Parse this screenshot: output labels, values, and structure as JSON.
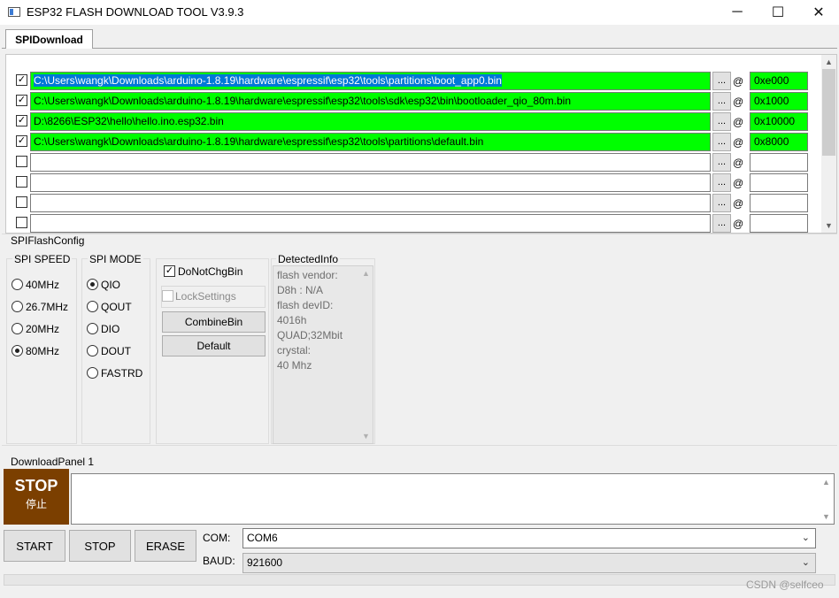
{
  "window": {
    "title": "ESP32 FLASH DOWNLOAD TOOL V3.9.3",
    "minimize_symbol": "─",
    "maximize_symbol": "☐",
    "close_symbol": "✕"
  },
  "tabs": [
    {
      "label": "SPIDownload"
    }
  ],
  "files": [
    {
      "checked": true,
      "check_mark": "✓",
      "path_highlight": "C:\\Users\\wangk\\Downloads\\arduino-1.8.19\\hardware\\espressif\\esp32\\tools\\partitions\\boot_app0.bin",
      "path": "",
      "browse": "...",
      "at": "@",
      "address": "0xe000"
    },
    {
      "checked": true,
      "check_mark": "✓",
      "path_highlight": "",
      "path": "C:\\Users\\wangk\\Downloads\\arduino-1.8.19\\hardware\\espressif\\esp32\\tools\\sdk\\esp32\\bin\\bootloader_qio_80m.bin",
      "browse": "...",
      "at": "@",
      "address": "0x1000"
    },
    {
      "checked": true,
      "check_mark": "✓",
      "path_highlight": "",
      "path": "D:\\8266\\ESP32\\hello\\hello.ino.esp32.bin",
      "browse": "...",
      "at": "@",
      "address": "0x10000"
    },
    {
      "checked": true,
      "check_mark": "✓",
      "path_highlight": "",
      "path": "C:\\Users\\wangk\\Downloads\\arduino-1.8.19\\hardware\\espressif\\esp32\\tools\\partitions\\default.bin",
      "browse": "...",
      "at": "@",
      "address": "0x8000"
    },
    {
      "checked": false,
      "check_mark": "",
      "path_highlight": "",
      "path": "",
      "browse": "...",
      "at": "@",
      "address": ""
    },
    {
      "checked": false,
      "check_mark": "",
      "path_highlight": "",
      "path": "",
      "browse": "...",
      "at": "@",
      "address": ""
    },
    {
      "checked": false,
      "check_mark": "",
      "path_highlight": "",
      "path": "",
      "browse": "...",
      "at": "@",
      "address": ""
    },
    {
      "checked": false,
      "check_mark": "",
      "path_highlight": "",
      "path": "",
      "browse": "...",
      "at": "@",
      "address": ""
    }
  ],
  "scroll": {
    "up_arrow": "▲",
    "down_arrow": "▼"
  },
  "config": {
    "title": "SPIFlashConfig",
    "spi_speed": {
      "title": "SPI SPEED",
      "options": [
        "40MHz",
        "26.7MHz",
        "20MHz",
        "80MHz"
      ],
      "selected": "80MHz"
    },
    "spi_mode": {
      "title": "SPI MODE",
      "options": [
        "QIO",
        "QOUT",
        "DIO",
        "DOUT",
        "FASTRD"
      ],
      "selected": "QIO"
    },
    "do_not_chg_bin": {
      "label": "DoNotChgBin",
      "checked": true,
      "check_mark": "✓"
    },
    "lock_settings": {
      "label": "LockSettings",
      "checked": false
    },
    "combine_bin_label": "CombineBin",
    "default_label": "Default",
    "detected_info": {
      "title": "DetectedInfo",
      "lines": [
        "flash vendor:",
        "D8h : N/A",
        "flash devID:",
        "4016h",
        "QUAD;32Mbit",
        "crystal:",
        "40 Mhz"
      ]
    }
  },
  "download_panel": {
    "title": "DownloadPanel 1",
    "status_big": "STOP",
    "status_small": "停止",
    "status_color": "#7b3f00",
    "start_label": "START",
    "stop_label": "STOP",
    "erase_label": "ERASE",
    "com_label": "COM:",
    "com_value": "COM6",
    "baud_label": "BAUD:",
    "baud_value": "921600",
    "chevron": "⌄"
  },
  "watermark": "CSDN @selfceo",
  "colors": {
    "loaded_file": "#00ff00",
    "selection": "#0078d7"
  }
}
